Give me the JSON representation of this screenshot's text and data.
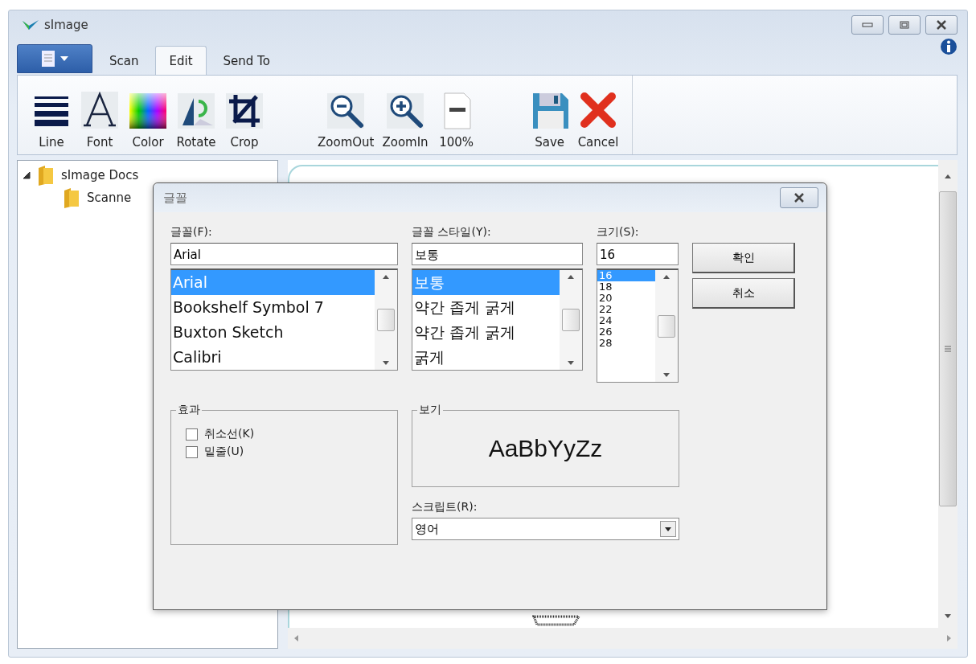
{
  "window": {
    "title": "sImage"
  },
  "tabs": [
    {
      "label": "Scan",
      "selected": false
    },
    {
      "label": "Edit",
      "selected": true
    },
    {
      "label": "Send To",
      "selected": false
    }
  ],
  "toolbar": [
    [
      {
        "label": "Line",
        "kind": "line"
      },
      {
        "label": "Font",
        "kind": "font"
      },
      {
        "label": "Color",
        "kind": "color"
      },
      {
        "label": "Rotate",
        "kind": "rotate"
      },
      {
        "label": "Crop",
        "kind": "crop"
      }
    ],
    [
      {
        "label": "ZoomOut",
        "kind": "zoomout"
      },
      {
        "label": "ZoomIn",
        "kind": "zoomin"
      },
      {
        "label": "100%",
        "kind": "actual"
      }
    ],
    [
      {
        "label": "Save",
        "kind": "save"
      },
      {
        "label": "Cancel",
        "kind": "cancel"
      }
    ]
  ],
  "tree": [
    {
      "label": "sImage Docs",
      "expanded": true,
      "children": [
        {
          "label": "Scanne"
        }
      ]
    }
  ],
  "dialog": {
    "title": "글꼴",
    "font": {
      "label": "글꼴(F):",
      "value": "Arial",
      "options": [
        {
          "label": "Arial",
          "selected": true
        },
        {
          "label": "Bookshelf Symbol 7",
          "selected": false
        },
        {
          "label": "Buxton Sketch",
          "selected": false
        },
        {
          "label": "Calibri",
          "selected": false
        }
      ]
    },
    "style": {
      "label": "글꼴 스타일(Y):",
      "value": "보통",
      "options": [
        {
          "label": "보통",
          "selected": true
        },
        {
          "label": "약간 좁게 굵게",
          "selected": false
        },
        {
          "label": "약간 좁게 굵게",
          "selected": false
        },
        {
          "label": "굵게",
          "selected": false
        }
      ]
    },
    "size": {
      "label": "크기(S):",
      "value": "16",
      "options": [
        {
          "label": "16",
          "selected": true
        },
        {
          "label": "18",
          "selected": false
        },
        {
          "label": "20",
          "selected": false
        },
        {
          "label": "22",
          "selected": false
        },
        {
          "label": "24",
          "selected": false
        },
        {
          "label": "26",
          "selected": false
        },
        {
          "label": "28",
          "selected": false
        }
      ]
    },
    "buttons": [
      "확인",
      "취소"
    ],
    "effects": {
      "title": "효과",
      "options": [
        {
          "label": "취소선(K)",
          "checked": false
        },
        {
          "label": "밑줄(U)",
          "checked": false
        }
      ]
    },
    "preview": {
      "title": "보기",
      "sample": "AaBbYyZz"
    },
    "script": {
      "label": "스크립트(R):",
      "value": "영어"
    }
  }
}
